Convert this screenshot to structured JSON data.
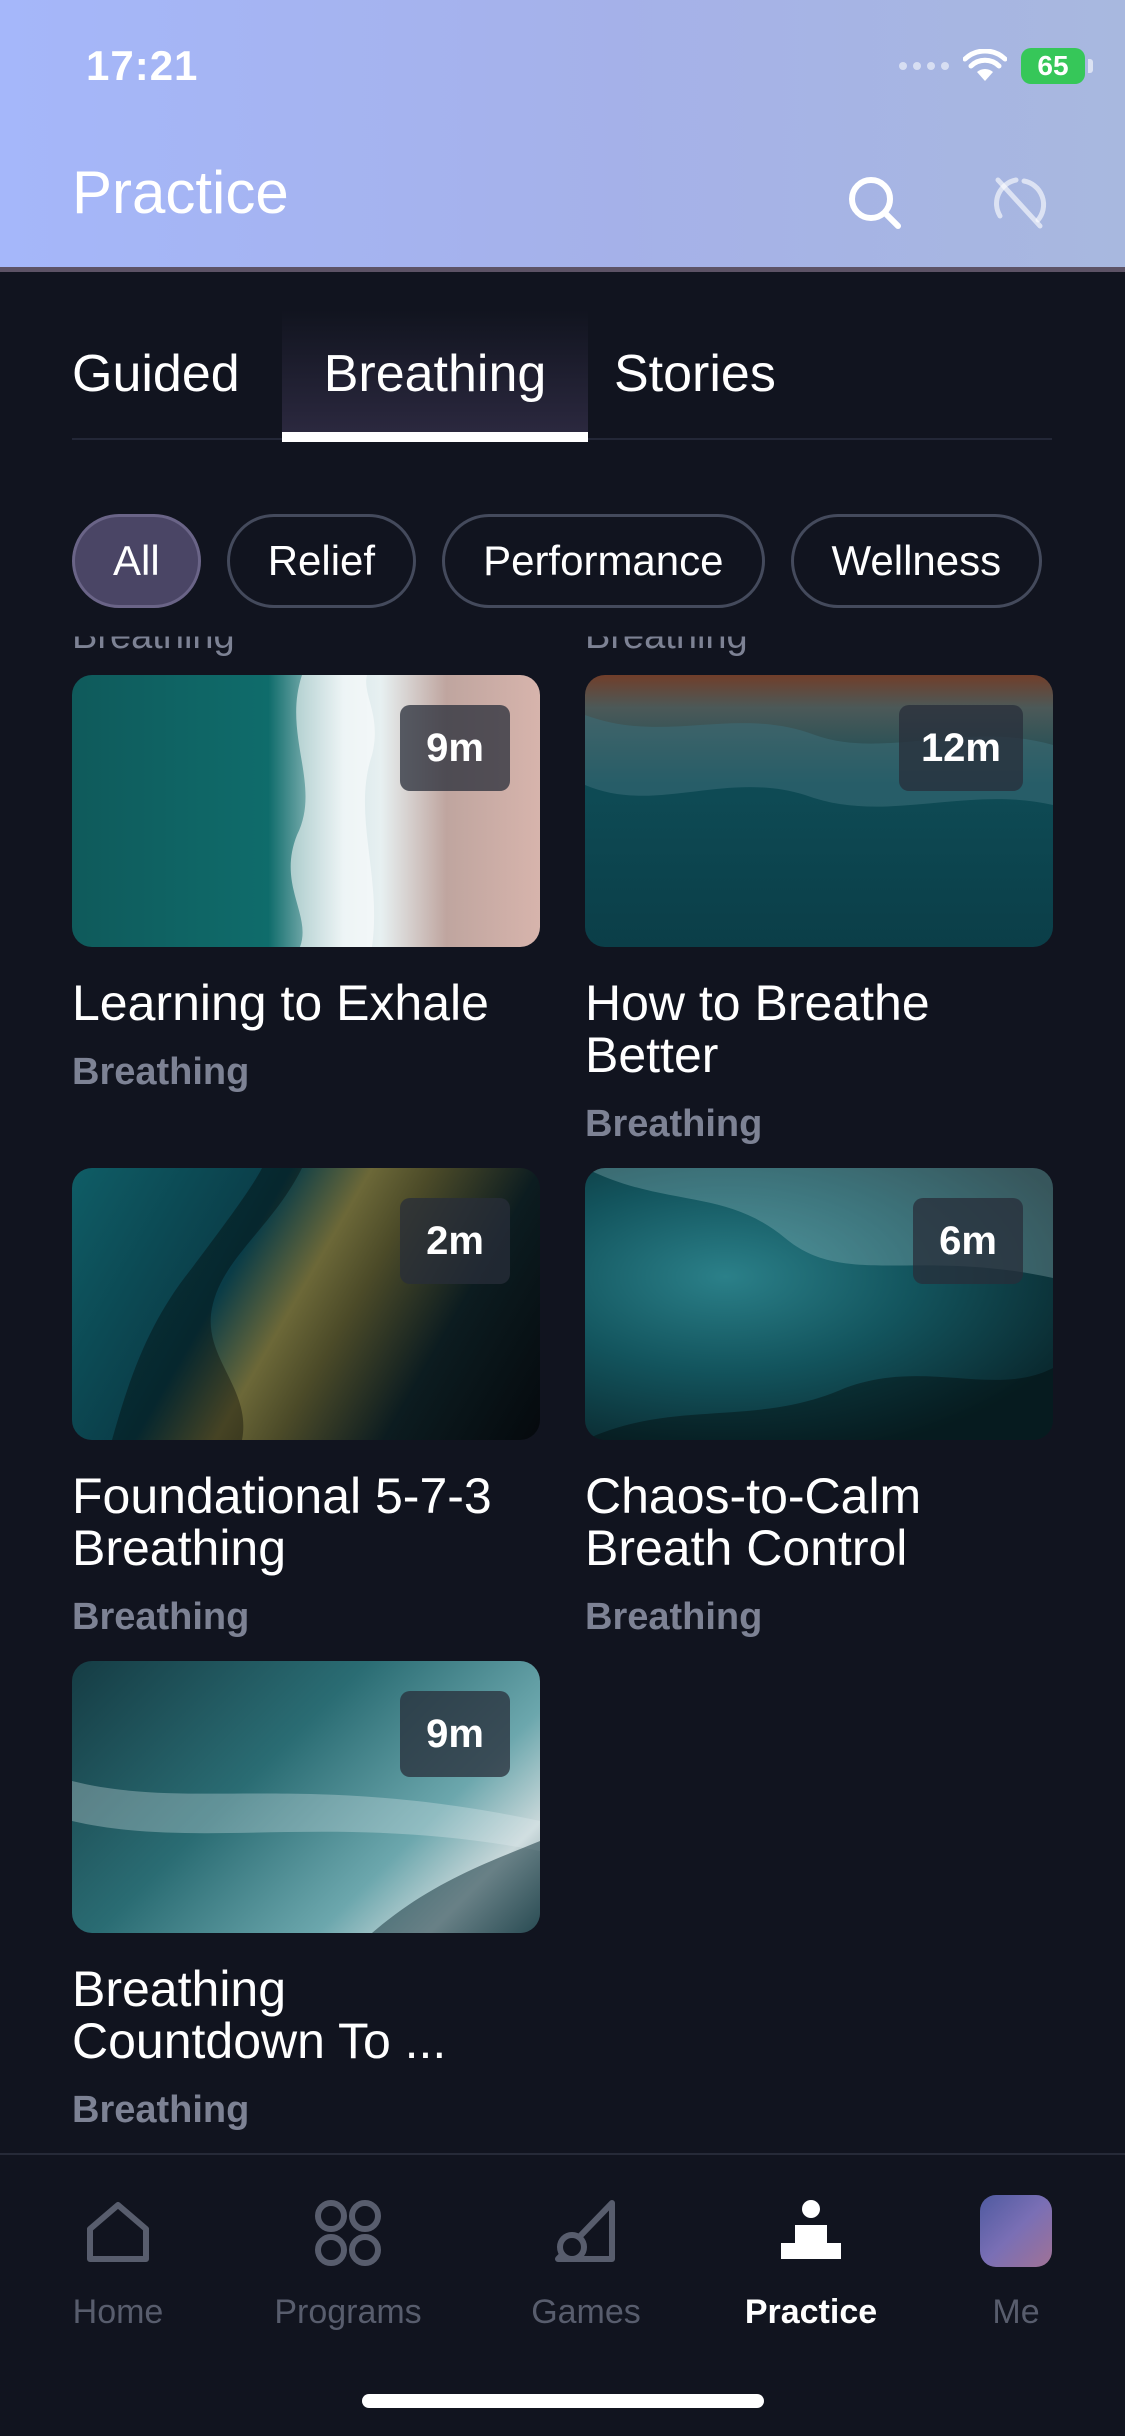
{
  "status_bar": {
    "time": "17:21",
    "battery": "65"
  },
  "header": {
    "title": "Practice"
  },
  "tabs": [
    {
      "label": "Guided"
    },
    {
      "label": "Breathing"
    },
    {
      "label": "Stories"
    }
  ],
  "filters": [
    {
      "label": "All"
    },
    {
      "label": "Relief"
    },
    {
      "label": "Performance"
    },
    {
      "label": "Wellness"
    }
  ],
  "clipped_labels": [
    "Breathing",
    "Breathing"
  ],
  "cards": [
    {
      "title": "Learning to Exhale",
      "category": "Breathing",
      "duration": "9m"
    },
    {
      "title": "How to Breathe Better",
      "category": "Breathing",
      "duration": "12m"
    },
    {
      "title": "Foundational 5-7-3 Breathing",
      "category": "Breathing",
      "duration": "2m"
    },
    {
      "title": "Chaos-to-Calm Breath Control",
      "category": "Breathing",
      "duration": "6m"
    },
    {
      "title": "Breathing Countdown To ...",
      "category": "Breathing",
      "duration": "9m"
    }
  ],
  "bottom_nav": [
    {
      "label": "Home",
      "icon": "home-icon"
    },
    {
      "label": "Programs",
      "icon": "grid-icon"
    },
    {
      "label": "Games",
      "icon": "games-icon"
    },
    {
      "label": "Practice",
      "icon": "practice-icon"
    },
    {
      "label": "Me",
      "icon": "avatar"
    }
  ],
  "colors": {
    "background": "#11141f",
    "header_gradient_start": "#a5b7fa",
    "battery": "#36c759"
  }
}
